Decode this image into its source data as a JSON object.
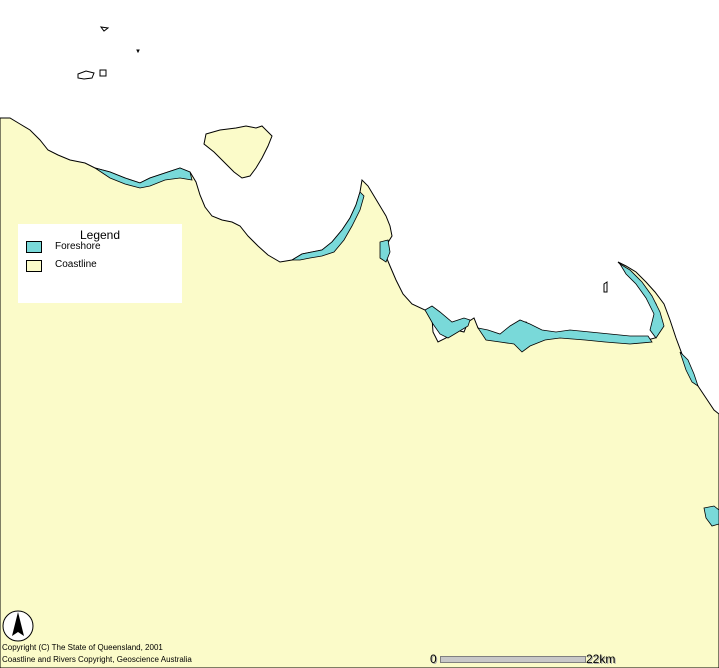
{
  "colors": {
    "sea": "#ffffff",
    "coastline": "#fbfbc9",
    "foreshore": "#79d9d9",
    "outline": "#000000"
  },
  "legend": {
    "title": "Legend",
    "items": [
      {
        "label": "Foreshore",
        "color": "#79d9d9"
      },
      {
        "label": "Coastline",
        "color": "#fbfbc9"
      }
    ]
  },
  "copyright": {
    "line1": "Copyright (C) The State of Queensland, 2001",
    "line2": "Coastline and Rivers Copyright, Geoscience Australia"
  },
  "scalebar": {
    "start_label": "0",
    "end_label": "22km"
  },
  "north_arrow": {
    "icon": "north-arrow-icon"
  }
}
